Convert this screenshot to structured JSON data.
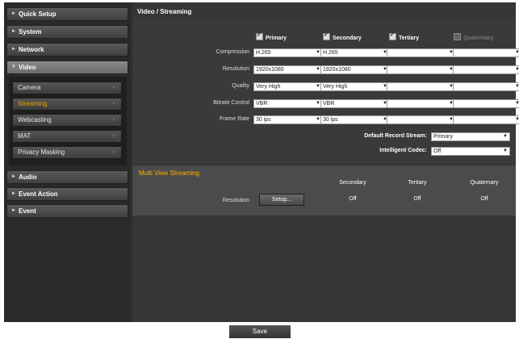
{
  "sidebar": {
    "items": [
      {
        "label": "Quick Setup"
      },
      {
        "label": "System"
      },
      {
        "label": "Network"
      },
      {
        "label": "Video"
      },
      {
        "label": "Audio"
      },
      {
        "label": "Event Action"
      },
      {
        "label": "Event"
      }
    ],
    "video_sub": [
      {
        "label": "Camera"
      },
      {
        "label": "Streaming"
      },
      {
        "label": "Webcasting"
      },
      {
        "label": "MAT"
      },
      {
        "label": "Privacy Masking"
      }
    ]
  },
  "main": {
    "title": "Video / Streaming",
    "columns": [
      {
        "label": "Primary",
        "checked": true
      },
      {
        "label": "Secondary",
        "checked": true
      },
      {
        "label": "Tertiary",
        "checked": true
      },
      {
        "label": "Quaternary",
        "checked": false
      }
    ],
    "rows": [
      {
        "label": "Compression",
        "values": [
          "H.265",
          "H.265",
          "",
          ""
        ]
      },
      {
        "label": "Resolution",
        "values": [
          "1920x1080",
          "1920x1080",
          "",
          ""
        ]
      },
      {
        "label": "Quality",
        "values": [
          "Very High",
          "Very High",
          "",
          ""
        ]
      },
      {
        "label": "Bitrate Control",
        "values": [
          "VBR",
          "VBR",
          "",
          ""
        ]
      },
      {
        "label": "Frame Rate",
        "values": [
          "30 ips",
          "30 ips",
          "",
          ""
        ]
      }
    ],
    "default_record_stream": {
      "label": "Default Record Stream",
      "value": "Primary"
    },
    "intelligent_codec": {
      "label": "Intelligent Codec",
      "value": "Off"
    }
  },
  "multiview": {
    "title": "Multi View Streaming",
    "row_label": "Resolution",
    "setup_label": "Setup...",
    "columns": [
      {
        "label": "Secondary",
        "value": "Off"
      },
      {
        "label": "Tertiary",
        "value": "Off"
      },
      {
        "label": "Quaternary",
        "value": "Off"
      }
    ]
  },
  "footer": {
    "save_label": "Save"
  }
}
